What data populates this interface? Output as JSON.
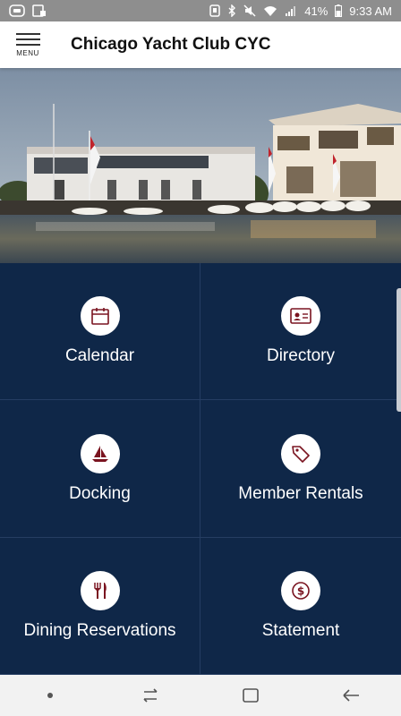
{
  "status_bar": {
    "battery_percent": "41%",
    "time": "9:33 AM",
    "icons": [
      "cast-icon",
      "screenshot-icon",
      "nfc-icon",
      "bluetooth-icon",
      "mute-icon",
      "wifi-icon",
      "signal-icon",
      "battery-icon"
    ]
  },
  "app_bar": {
    "menu_label": "MENU",
    "title": "Chicago Yacht Club CYC"
  },
  "hero": {
    "description_icon": "yacht-club-photo"
  },
  "tiles": [
    {
      "label": "Calendar",
      "icon": "calendar-icon"
    },
    {
      "label": "Directory",
      "icon": "id-card-icon"
    },
    {
      "label": "Docking",
      "icon": "sailboat-icon"
    },
    {
      "label": "Member Rentals",
      "icon": "tag-icon"
    },
    {
      "label": "Dining Reservations",
      "icon": "fork-knife-icon"
    },
    {
      "label": "Statement",
      "icon": "dollar-icon"
    }
  ],
  "nav_bar": {
    "icons": [
      "dot-icon",
      "recents-icon",
      "home-icon",
      "back-icon"
    ]
  },
  "colors": {
    "grid_bg": "#0f2748",
    "icon_accent": "#7a1420",
    "status_bar": "#8e8e8e"
  }
}
